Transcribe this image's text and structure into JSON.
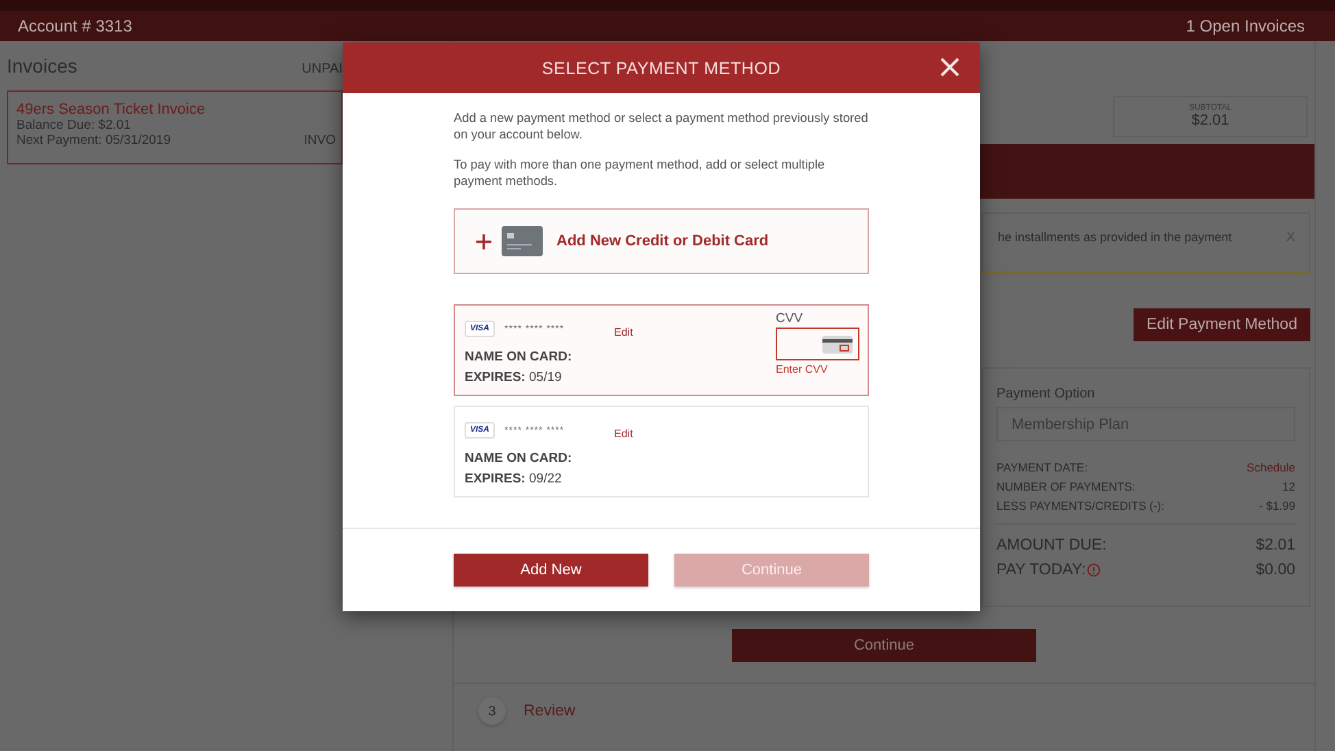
{
  "top_bar": {
    "account": "Account # 3313",
    "open_invoices": "1 Open Invoices"
  },
  "invoices": {
    "title": "Invoices",
    "filter": "UNPAI",
    "items": [
      {
        "title": "49ers Season Ticket Invoice",
        "balance": "Balance Due: $2.01",
        "next_payment": "Next Payment: 05/31/2019",
        "tag": "INVO",
        "selected": true
      }
    ]
  },
  "checkout": {
    "subtotal_label": "SUBTOTAL",
    "subtotal": "$2.01",
    "notice": "he installments as provided in the payment",
    "notice_close": "X",
    "edit_button": "Edit Payment Method",
    "payment_option_label": "Payment Option",
    "payment_option": "Membership Plan",
    "rows": [
      {
        "label": "PAYMENT DATE:",
        "value": "Schedule",
        "kind": "link"
      },
      {
        "label": "NUMBER OF PAYMENTS:",
        "value": "12",
        "kind": "plain"
      },
      {
        "label": "LESS PAYMENTS/CREDITS (-):",
        "value": "- $1.99",
        "kind": "plain"
      }
    ],
    "amount_due_label": "AMOUNT DUE:",
    "amount_due": "$2.01",
    "pay_today_label": "PAY TODAY:",
    "pay_today": "$0.00",
    "continue": "Continue",
    "steps": [
      {
        "number": "3",
        "label": "Review"
      }
    ]
  },
  "modal": {
    "title": "SELECT PAYMENT METHOD",
    "intro": [
      "Add a new payment method or select a payment method previously stored on your account below.",
      "To pay with more than one payment method, add or select multiple payment methods."
    ],
    "add_card": "Add New Credit or Debit Card",
    "cards": [
      {
        "brand": "VISA",
        "number": "**** **** ****",
        "edit": "Edit",
        "name_label": "NAME ON CARD:",
        "expires_label": "EXPIRES:",
        "expires": "05/19",
        "selected": true,
        "cvv": {
          "label": "CVV",
          "hint": "Enter CVV",
          "error": true
        }
      },
      {
        "brand": "VISA",
        "number": "**** **** ****",
        "edit": "Edit",
        "name_label": "NAME ON CARD:",
        "expires_label": "EXPIRES:",
        "expires": "09/22",
        "selected": false
      }
    ],
    "buttons": [
      {
        "label": "Add New",
        "disabled": false
      },
      {
        "label": "Continue",
        "disabled": true
      }
    ]
  }
}
